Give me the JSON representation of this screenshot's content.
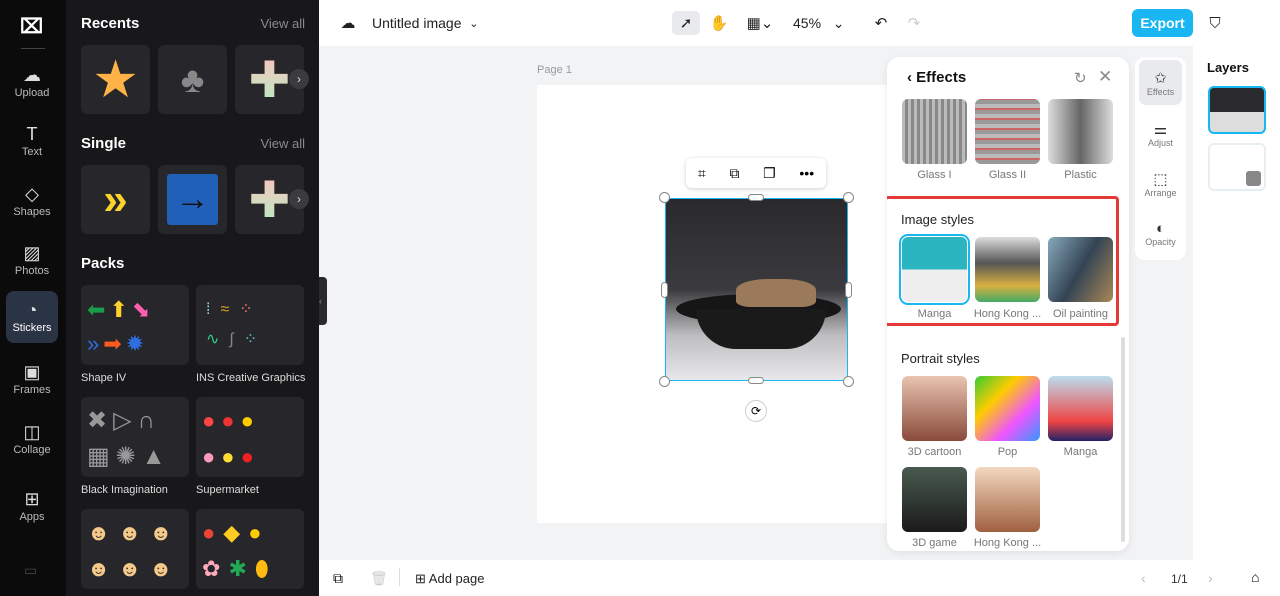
{
  "nav": {
    "items": [
      {
        "label": "Upload",
        "icon": "upload-cloud-icon"
      },
      {
        "label": "Text",
        "icon": "text-icon"
      },
      {
        "label": "Shapes",
        "icon": "shapes-icon"
      },
      {
        "label": "Photos",
        "icon": "photo-icon"
      },
      {
        "label": "Stickers",
        "icon": "sticker-icon"
      },
      {
        "label": "Frames",
        "icon": "frame-icon"
      },
      {
        "label": "Collage",
        "icon": "collage-icon"
      },
      {
        "label": "Apps",
        "icon": "apps-icon"
      }
    ],
    "active": "Stickers"
  },
  "panel": {
    "recents": {
      "title": "Recents",
      "view_all": "View all"
    },
    "single": {
      "title": "Single",
      "view_all": "View all"
    },
    "packs": {
      "title": "Packs",
      "items": [
        "Shape IV",
        "INS Creative Graphics",
        "Black Imagination",
        "Supermarket"
      ]
    }
  },
  "topbar": {
    "title": "Untitled image",
    "zoom": "45%",
    "export": "Export"
  },
  "canvas": {
    "page_label": "Page 1"
  },
  "effects": {
    "title": "Effects",
    "top_items": [
      "Glass I",
      "Glass II",
      "Plastic"
    ],
    "image_styles": {
      "title": "Image styles",
      "items": [
        "Manga",
        "Hong Kong ...",
        "Oil painting"
      ],
      "selected": "Manga"
    },
    "portrait_styles": {
      "title": "Portrait styles",
      "items": [
        "3D cartoon",
        "Pop",
        "Manga",
        "3D game",
        "Hong Kong ..."
      ]
    }
  },
  "tools": [
    "Effects",
    "Adjust",
    "Arrange",
    "Opacity"
  ],
  "layers": {
    "title": "Layers"
  },
  "bottom": {
    "add_page": "Add page",
    "page_count": "1/1"
  },
  "colors": {
    "accent": "#19b6f2",
    "highlight": "#e53935",
    "nav_bg": "#0b0b0c",
    "panel_bg": "#18181b"
  }
}
